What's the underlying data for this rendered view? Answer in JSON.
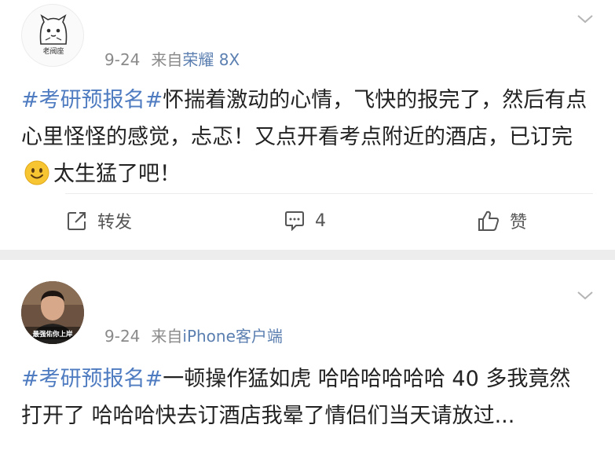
{
  "posts": [
    {
      "avatar_label": "老阀座",
      "time": "9-24",
      "source_prefix": "来自",
      "source": "荣耀 8X",
      "hashtag": "#考研预报名#",
      "text_part1": "怀揣着激动的心情，飞快的报完了，然后有点心里怪怪的感觉，忐忑！又点开看考点附近的酒店，已订完",
      "emoji": "smile-emoji",
      "text_part2": "太生猛了吧！",
      "actions": {
        "repost_label": "转发",
        "comment_count": "4",
        "like_label": "赞"
      }
    },
    {
      "avatar_label": "最强佑你上岸",
      "time": "9-24",
      "source_prefix": "来自",
      "source": "iPhone客户端",
      "hashtag": "#考研预报名#",
      "text_part1": "一顿操作猛如虎 哈哈哈哈哈哈 40 多我竟然打开了 哈哈哈快去订酒店我晕了情侣们当天请放过..."
    }
  ],
  "colors": {
    "link": "#4f7cc1",
    "source_link": "#5b7fb0",
    "meta_gray": "#8a8a8a",
    "background": "#ededed"
  },
  "icons": [
    "repost-icon",
    "comment-icon",
    "like-icon",
    "chevron-down-icon",
    "smile-emoji"
  ]
}
